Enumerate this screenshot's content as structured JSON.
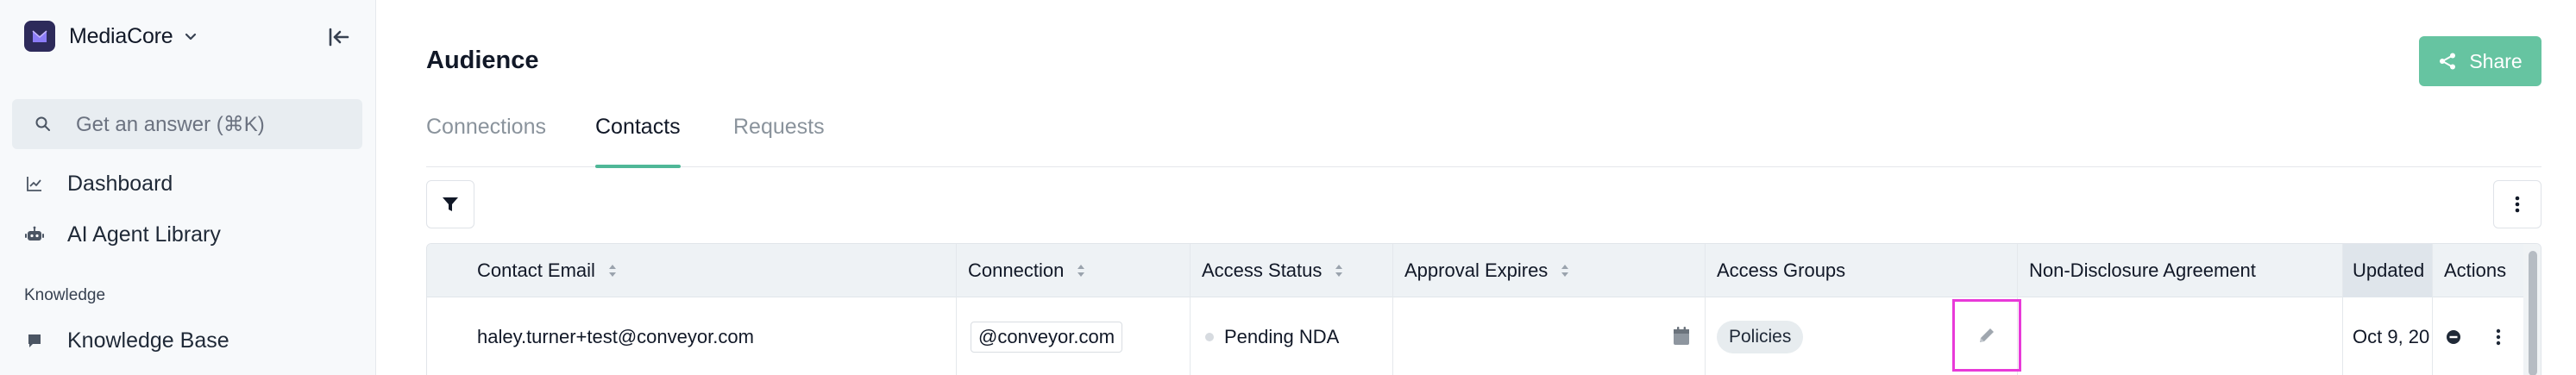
{
  "sidebar": {
    "brand_name": "MediaCore",
    "search_placeholder": "Get an answer (⌘K)",
    "nav": [
      {
        "label": "Dashboard",
        "icon": "chart-line-icon"
      },
      {
        "label": "AI Agent Library",
        "icon": "robot-icon"
      }
    ],
    "section_label": "Knowledge",
    "knowledge_items": [
      {
        "label": "Knowledge Base",
        "icon": "chat-bubble-icon"
      }
    ]
  },
  "header": {
    "title": "Audience",
    "share_label": "Share"
  },
  "tabs": [
    {
      "label": "Connections",
      "active": false
    },
    {
      "label": "Contacts",
      "active": true
    },
    {
      "label": "Requests",
      "active": false
    }
  ],
  "table": {
    "columns": [
      "Contact Email",
      "Connection",
      "Access Status",
      "Approval Expires",
      "Access Groups",
      "Non-Disclosure Agreement",
      "Updated",
      "Actions"
    ],
    "rows": [
      {
        "contact_email": "haley.turner+test@conveyor.com",
        "connection": "@conveyor.com",
        "access_status": "Pending NDA",
        "approval_expires": "",
        "access_group": "Policies",
        "nda": "",
        "updated": "Oct 9, 20"
      }
    ]
  },
  "colors": {
    "accent": "#4fb797",
    "share_button": "#66c4a1",
    "brand_logo": "#2d2a5a",
    "highlight_box": "#e83ad8"
  }
}
